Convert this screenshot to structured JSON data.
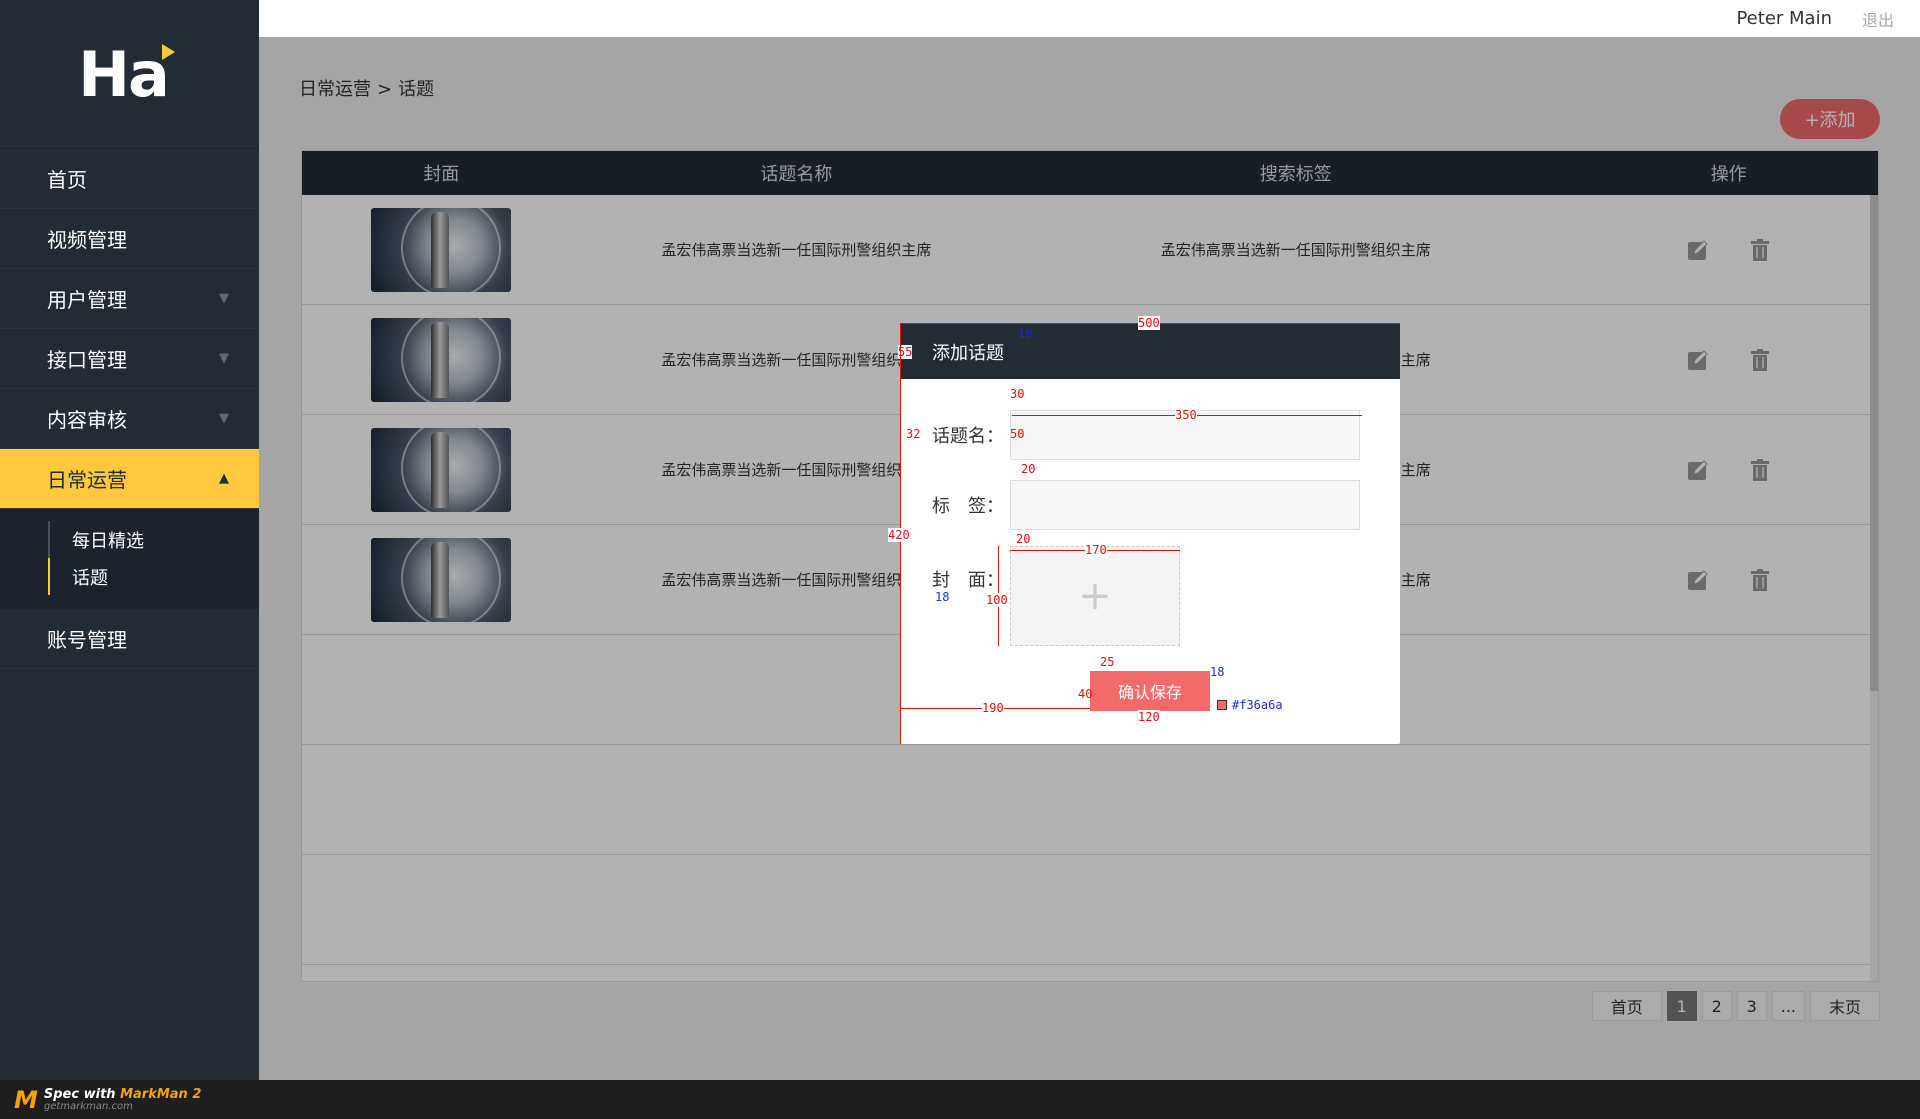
{
  "logo": {
    "text": "Ha"
  },
  "header": {
    "user_name": "Peter Main",
    "logout": "退出"
  },
  "sidebar": {
    "items": [
      {
        "label": "首页",
        "arrow": ""
      },
      {
        "label": "视频管理",
        "arrow": ""
      },
      {
        "label": "用户管理",
        "arrow": "▼"
      },
      {
        "label": "接口管理",
        "arrow": "▼"
      },
      {
        "label": "内容审核",
        "arrow": "▼"
      },
      {
        "label": "日常运营",
        "arrow": "▲"
      },
      {
        "label": "账号管理",
        "arrow": ""
      }
    ],
    "sub_items": [
      {
        "label": "每日精选"
      },
      {
        "label": "话题"
      }
    ]
  },
  "breadcrumb": {
    "parent": "日常运营",
    "sep": ">",
    "current": "话题"
  },
  "toolbar": {
    "add_label": "+添加"
  },
  "table": {
    "headers": {
      "cover": "封面",
      "name": "话题名称",
      "tag": "搜索标签",
      "op": "操作"
    },
    "rows": [
      {
        "name": "孟宏伟高票当选新一任国际刑警组织主席",
        "tag": "孟宏伟高票当选新一任国际刑警组织主席"
      },
      {
        "name": "孟宏伟高票当选新一任国际刑警组织主席",
        "tag": "孟宏伟高票当选新一任国际刑警组织主席"
      },
      {
        "name": "孟宏伟高票当选新一任国际刑警组织主席",
        "tag": "孟宏伟高票当选新一任国际刑警组织主席"
      },
      {
        "name": "孟宏伟高票当选新一任国际刑警组织主席",
        "tag": "孟宏伟高票当选新一任国际刑警组织主席"
      }
    ]
  },
  "pager": {
    "first": "首页",
    "pages": [
      "1",
      "2",
      "3",
      "..."
    ],
    "last": "末页",
    "current": "1"
  },
  "modal": {
    "title": "添加话题",
    "name_label": "话题名：",
    "tag_label": "标　签：",
    "cover_label": "封　面：",
    "upload_plus": "+",
    "confirm_label": "确认保存"
  },
  "annotations": {
    "w500": "500",
    "h55": "55",
    "fs18a": "18",
    "gap30": "30",
    "pad32": "32",
    "w350": "350",
    "h50": "50",
    "gap20a": "20",
    "h420": "420",
    "gap20b": "20",
    "w170": "170",
    "fs18b": "18",
    "h100": "100",
    "gap25": "25",
    "fs18c": "18",
    "h40": "40",
    "left190": "190",
    "w120": "120",
    "color": "#f36a6a"
  },
  "footer": {
    "brand_prefix": "Spec with ",
    "brand": "MarkMan 2",
    "site": "getmarkman.com"
  },
  "colors": {
    "sidebar": "#232b35",
    "accent": "#ffc83d",
    "button": "#f36a6a"
  }
}
